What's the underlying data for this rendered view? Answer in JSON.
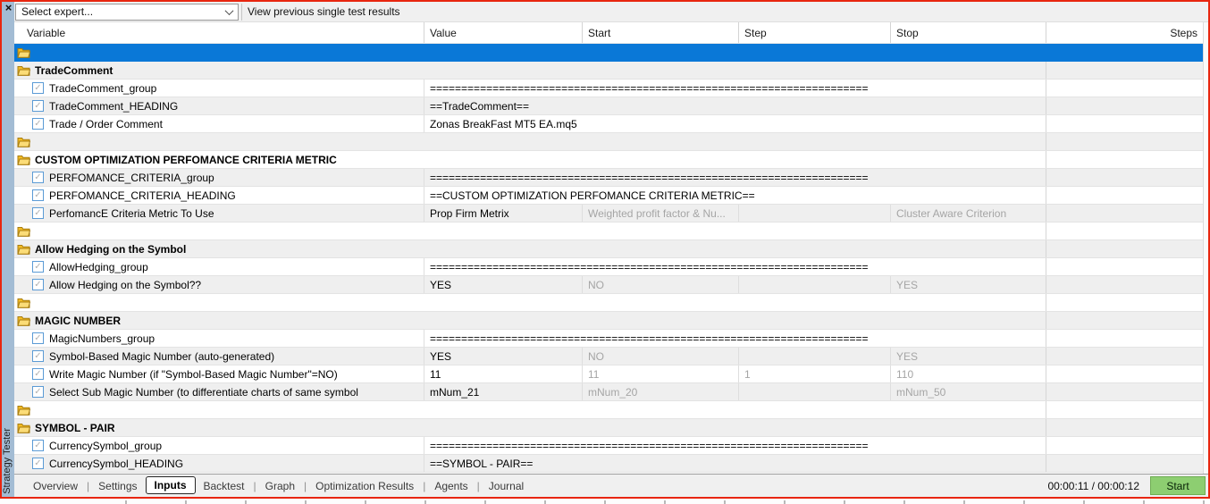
{
  "colors": {
    "selection_blue": "#0a78d7",
    "row_alt_gray": "#efefef",
    "sidebar_blue": "#a3bcd4",
    "folder_gold": "#f3bc24",
    "start_green": "#8dce71",
    "frame_red": "#e8260f"
  },
  "sidebar": {
    "title": "Strategy Tester",
    "close_icon": "×"
  },
  "toolbar": {
    "expert_selector": {
      "value": "Select expert...",
      "chevron_icon": "chevron-down"
    },
    "caption": "View previous single test results"
  },
  "table": {
    "columns": [
      "Variable",
      "Value",
      "Start",
      "Step",
      "Stop",
      "Steps"
    ],
    "rows": [
      {
        "kind": "folder",
        "selected": true,
        "label": ""
      },
      {
        "kind": "folder",
        "label": "TradeComment"
      },
      {
        "kind": "param",
        "checked": true,
        "variable": "TradeComment_group",
        "value": "======================================================================"
      },
      {
        "kind": "param",
        "checked": true,
        "variable": "TradeComment_HEADING",
        "value": "==TradeComment=="
      },
      {
        "kind": "param",
        "checked": true,
        "variable": "Trade / Order Comment",
        "value": "Zonas BreakFast MT5 EA.mq5"
      },
      {
        "kind": "folder",
        "label": ""
      },
      {
        "kind": "folder",
        "label": "CUSTOM OPTIMIZATION PERFOMANCE CRITERIA METRIC"
      },
      {
        "kind": "param",
        "checked": true,
        "variable": "PERFOMANCE_CRITERIA_group",
        "value": "======================================================================"
      },
      {
        "kind": "param",
        "checked": true,
        "variable": "PERFOMANCE_CRITERIA_HEADING",
        "value": "==CUSTOM OPTIMIZATION PERFOMANCE CRITERIA METRIC=="
      },
      {
        "kind": "param",
        "checked": true,
        "variable": "PerfomancE Criteria Metric To Use",
        "value": "Prop Firm Metrix",
        "start": "Weighted profit factor & Nu...",
        "step": "",
        "stop": "Cluster Aware Criterion"
      },
      {
        "kind": "folder",
        "label": ""
      },
      {
        "kind": "folder",
        "label": "Allow Hedging on the Symbol"
      },
      {
        "kind": "param",
        "checked": true,
        "variable": "AllowHedging_group",
        "value": "======================================================================"
      },
      {
        "kind": "param",
        "checked": true,
        "variable": "Allow Hedging on the Symbol??",
        "value": "YES",
        "start": "NO",
        "step": "",
        "stop": "YES"
      },
      {
        "kind": "folder",
        "label": ""
      },
      {
        "kind": "folder",
        "label": "MAGIC NUMBER"
      },
      {
        "kind": "param",
        "checked": true,
        "variable": "MagicNumbers_group",
        "value": "======================================================================"
      },
      {
        "kind": "param",
        "checked": true,
        "variable": "Symbol-Based Magic Number (auto-generated)",
        "value": "YES",
        "start": "NO",
        "step": "",
        "stop": "YES"
      },
      {
        "kind": "param",
        "checked": true,
        "variable": "Write Magic Number (if \"Symbol-Based Magic Number\"=NO)",
        "value": "11",
        "start": "11",
        "step": "1",
        "stop": "110"
      },
      {
        "kind": "param",
        "checked": true,
        "variable": "Select Sub Magic Number (to differentiate charts of same symbol",
        "value": "mNum_21",
        "start": "mNum_20",
        "step": "",
        "stop": "mNum_50"
      },
      {
        "kind": "folder",
        "label": ""
      },
      {
        "kind": "folder",
        "label": "SYMBOL - PAIR"
      },
      {
        "kind": "param",
        "checked": true,
        "variable": "CurrencySymbol_group",
        "value": "======================================================================"
      },
      {
        "kind": "param",
        "checked": true,
        "variable": "CurrencySymbol_HEADING",
        "value": "==SYMBOL - PAIR=="
      }
    ]
  },
  "tabs": [
    "Overview",
    "Settings",
    "Inputs",
    "Backtest",
    "Graph",
    "Optimization Results",
    "Agents",
    "Journal"
  ],
  "active_tab": "Inputs",
  "status": {
    "elapsed": "00:00:11 / 00:00:12",
    "start_button": "Start"
  }
}
